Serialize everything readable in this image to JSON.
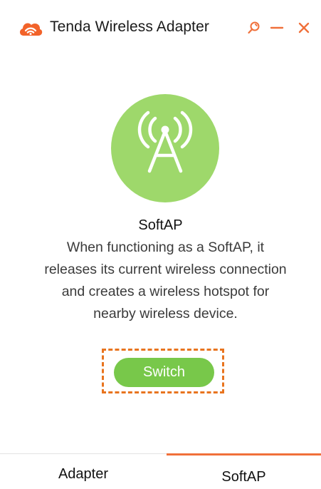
{
  "window": {
    "title": "Tenda Wireless Adapter",
    "icons": {
      "logo": "tenda-cloud-wifi-logo",
      "pin": "pin-icon",
      "minimize": "minimize-icon",
      "close": "close-icon"
    },
    "accent_color": "#f0703a"
  },
  "main": {
    "hero_icon": "antenna-tower-icon",
    "hero_color": "#9ed86b",
    "mode_title": "SoftAP",
    "description_lines": [
      "When functioning as a SoftAP, it",
      "releases its current wireless connection",
      "and creates a wireless hotspot for",
      "nearby wireless device."
    ],
    "switch_label": "Switch",
    "switch_color": "#78c84a",
    "highlight_color": "#e8741f"
  },
  "tabs": [
    {
      "label": "Adapter",
      "selected": false
    },
    {
      "label": "SoftAP",
      "selected": true
    }
  ]
}
